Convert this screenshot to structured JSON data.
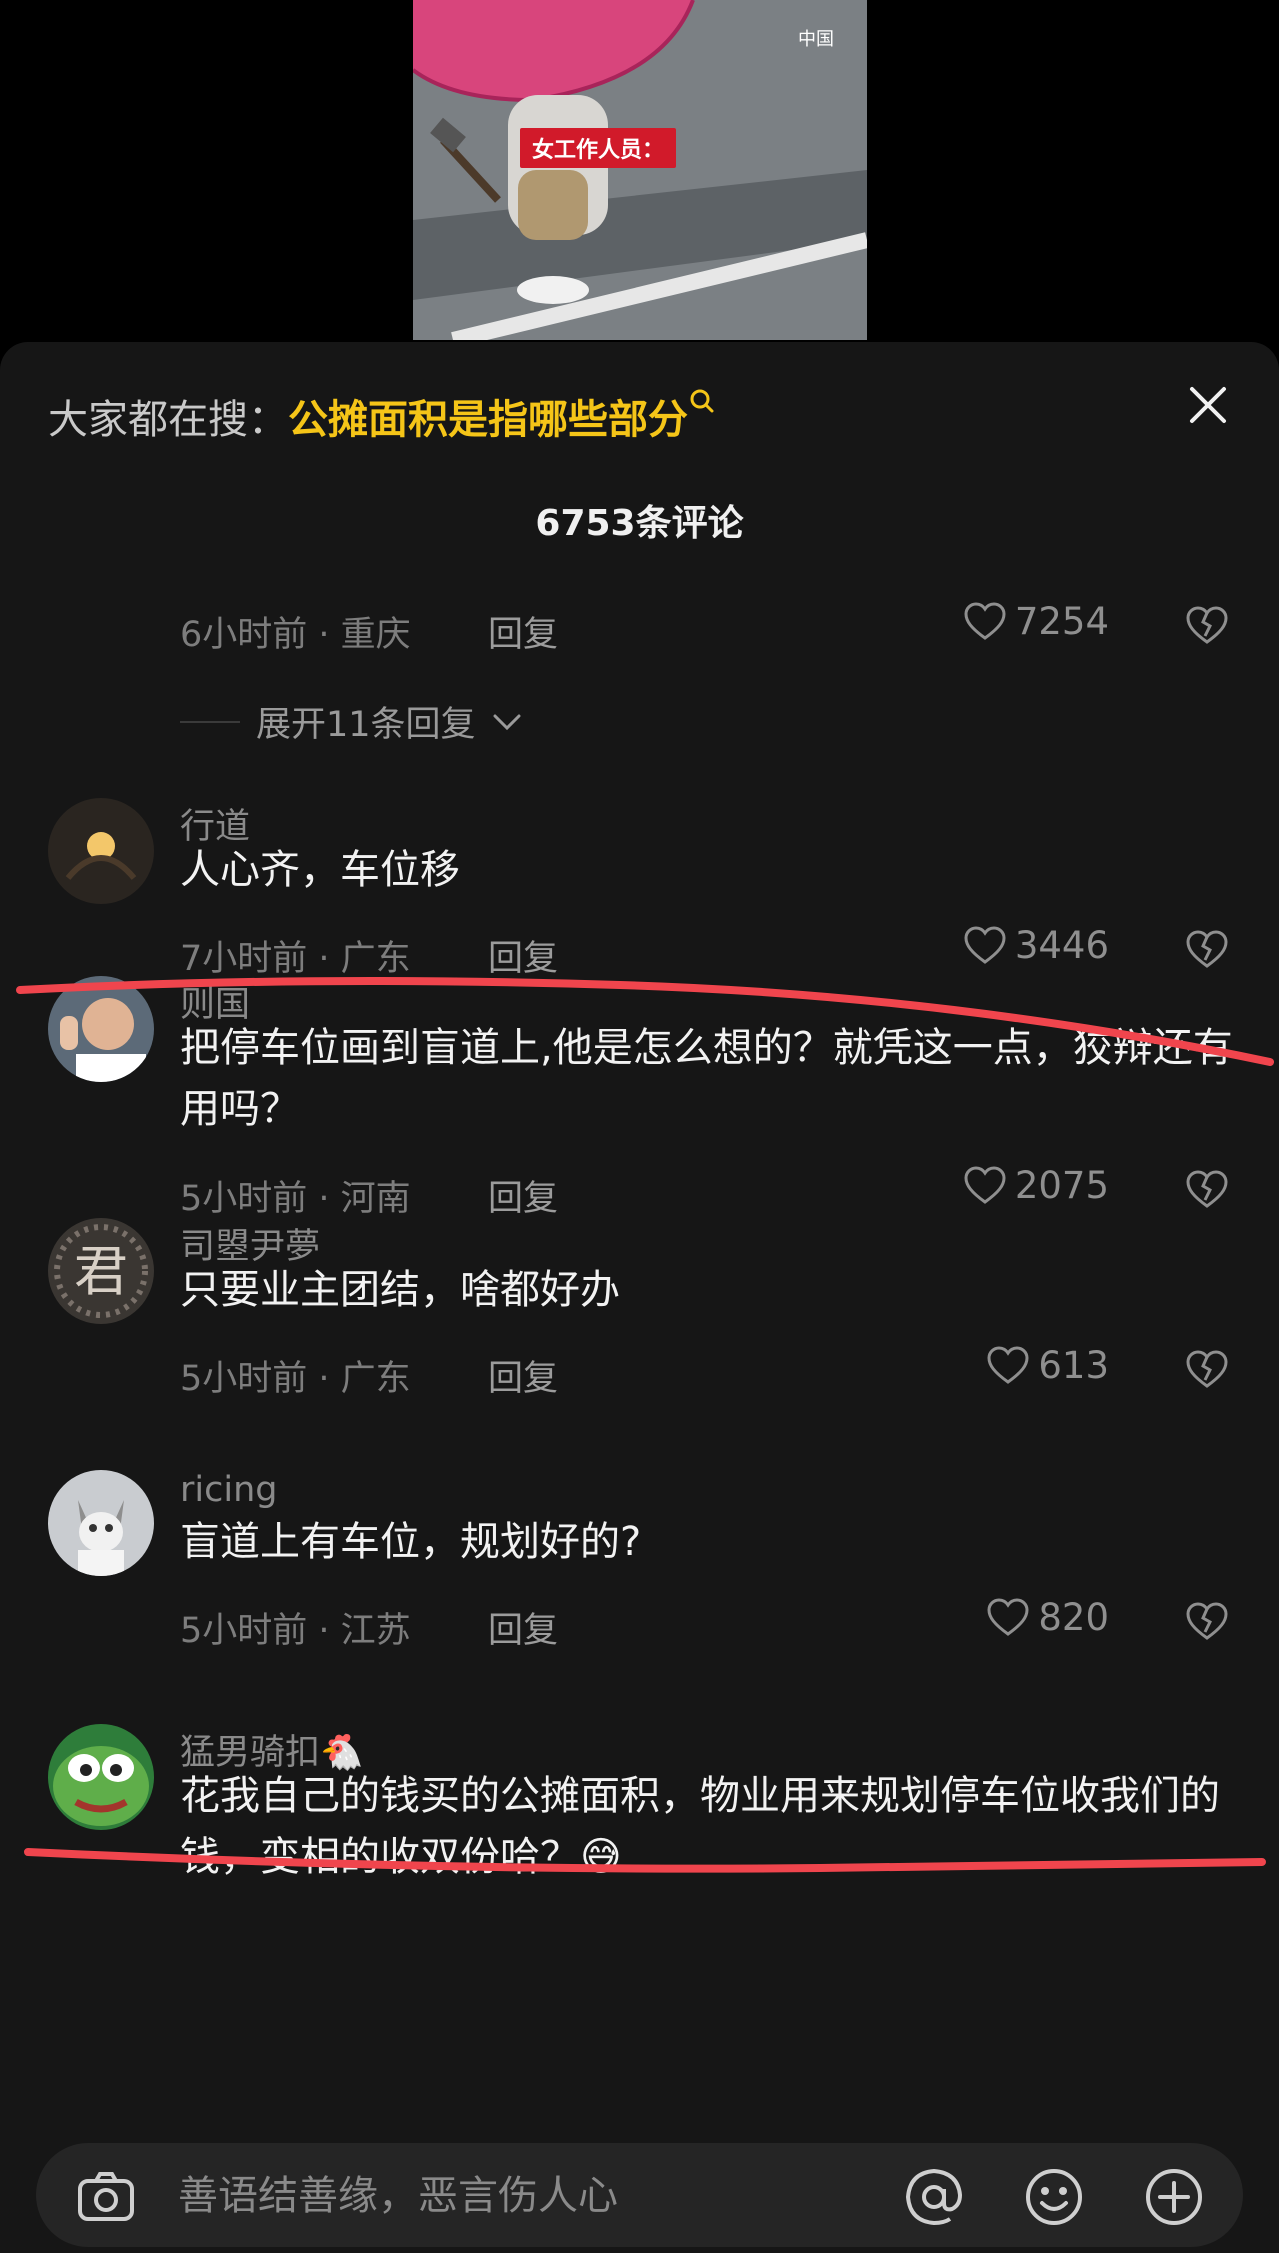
{
  "video": {
    "label": "女工作人员："
  },
  "search": {
    "prefix": "大家都在搜：",
    "query": "公摊面积是指哪些部分"
  },
  "comment_count": "6753条评论",
  "comments": [
    {
      "username": "",
      "content": "",
      "time_location": "6小时前 · 重庆",
      "reply": "回复",
      "likes": "7254"
    },
    {
      "username": "行道",
      "content": "人心齐，车位移",
      "time_location": "7小时前 · 广东",
      "reply": "回复",
      "likes": "3446"
    },
    {
      "username": "则国",
      "content": "把停车位画到盲道上,他是怎么想的？就凭这一点，狡辩还有用吗？",
      "time_location": "5小时前 · 河南",
      "reply": "回复",
      "likes": "2075"
    },
    {
      "username": "司曌尹夢",
      "content": "只要业主团结，啥都好办",
      "time_location": "5小时前 · 广东",
      "reply": "回复",
      "likes": "613"
    },
    {
      "username": "ricing",
      "content": "盲道上有车位，规划好的?",
      "time_location": "5小时前 · 江苏",
      "reply": "回复",
      "likes": "820"
    },
    {
      "username": "猛男骑扣🐔",
      "content": "花我自己的钱买的公摊面积，物业用来规划停车位收我们的钱，变相的收双份哈？😅",
      "time_location": "",
      "reply": "",
      "likes": ""
    }
  ],
  "expand_replies": "展开11条回复",
  "input": {
    "placeholder": "善语结善缘，恶言伤人心"
  },
  "colors": {
    "accent": "#f5c518",
    "annotation": "#f0454d",
    "panel": "#161616"
  },
  "icons": [
    "search-icon",
    "close-icon",
    "heart-icon",
    "dislike-icon",
    "chevron-down-icon",
    "camera-icon",
    "at-icon",
    "emoji-icon",
    "plus-icon"
  ]
}
